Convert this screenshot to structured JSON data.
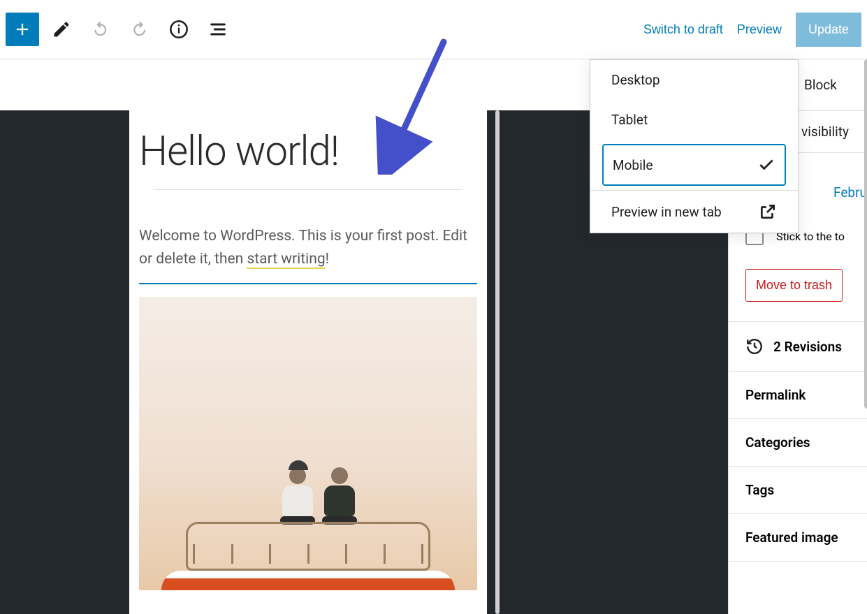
{
  "toolbar": {
    "switch_to_draft": "Switch to draft",
    "preview": "Preview",
    "update": "Update"
  },
  "preview_menu": {
    "desktop": "Desktop",
    "tablet": "Tablet",
    "mobile": "Mobile",
    "new_tab": "Preview in new tab"
  },
  "post": {
    "title": "Hello world!",
    "body_before_link": "Welcome to WordPress. This is your first post. Edit or delete it, then ",
    "body_link": "start writing",
    "body_after_link": "!"
  },
  "sidebar": {
    "block_tab": "Block",
    "visibility_label": "visibility",
    "date_text": "Febru",
    "stick_label": "Stick to the to",
    "move_to_trash": "Move to trash",
    "revisions": "2 Revisions",
    "permalink": "Permalink",
    "categories": "Categories",
    "tags": "Tags",
    "featured_image": "Featured image"
  }
}
